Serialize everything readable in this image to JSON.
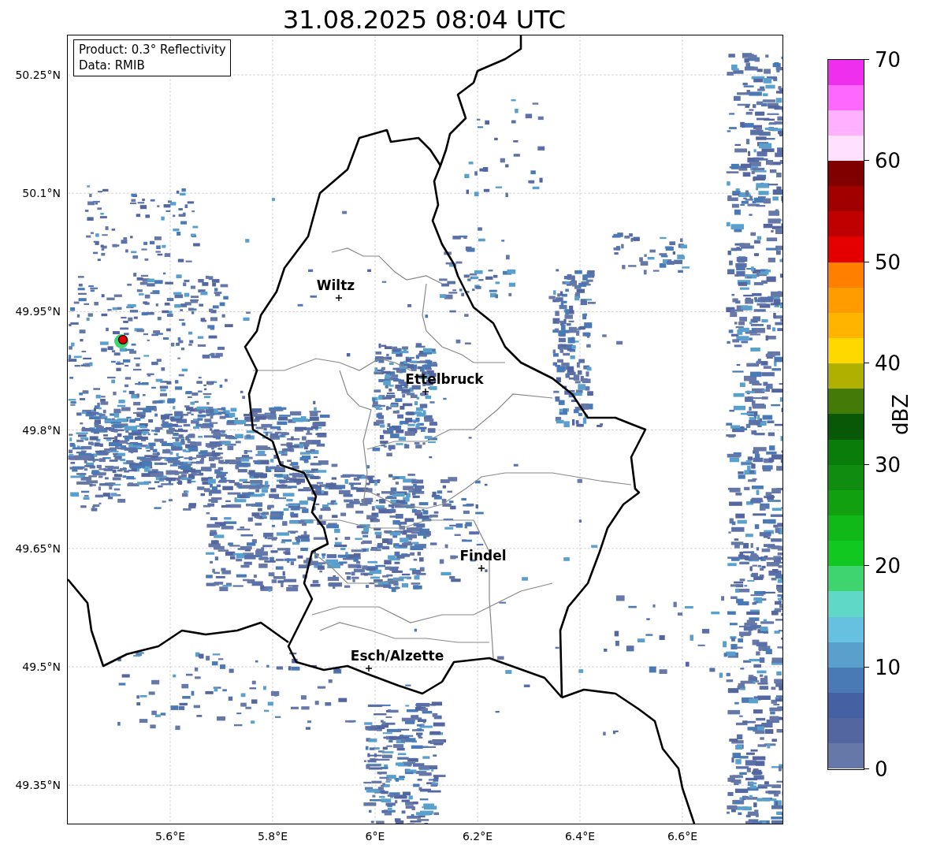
{
  "title": "31.08.2025 08:04 UTC",
  "info_box": [
    "Product: 0.3° Reflectivity",
    "Data: RMIB"
  ],
  "y_ticks": [
    "50.25°N",
    "50.1°N",
    "49.95°N",
    "49.8°N",
    "49.65°N",
    "49.5°N",
    "49.35°N"
  ],
  "x_ticks": [
    "5.6°E",
    "5.8°E",
    "6°E",
    "6.2°E",
    "6.4°E",
    "6.6°E"
  ],
  "cities": [
    {
      "name": "Wiltz"
    },
    {
      "name": "Ettelbruck"
    },
    {
      "name": "Findel"
    },
    {
      "name": "Esch/Alzette"
    }
  ],
  "colorbar": {
    "label": "dBZ",
    "ticks": [
      "70",
      "60",
      "50",
      "40",
      "30",
      "20",
      "10",
      "0"
    ],
    "bins": [
      {
        "color": "#ee30ee"
      },
      {
        "color": "#ff68ff"
      },
      {
        "color": "#ffb0ff"
      },
      {
        "color": "#ffe0ff"
      },
      {
        "color": "#800000"
      },
      {
        "color": "#a00000"
      },
      {
        "color": "#c00000"
      },
      {
        "color": "#e40000"
      },
      {
        "color": "#ff8000"
      },
      {
        "color": "#ff9c00"
      },
      {
        "color": "#ffb400"
      },
      {
        "color": "#ffd800"
      },
      {
        "color": "#b0b000"
      },
      {
        "color": "#447a08"
      },
      {
        "color": "#085808"
      },
      {
        "color": "#0a7c0a"
      },
      {
        "color": "#108c10"
      },
      {
        "color": "#10a010"
      },
      {
        "color": "#10b818"
      },
      {
        "color": "#10c820"
      },
      {
        "color": "#40d470"
      },
      {
        "color": "#60d8c8"
      },
      {
        "color": "#66c0e0"
      },
      {
        "color": "#5aa0cc"
      },
      {
        "color": "#4a7ab6"
      },
      {
        "color": "#4660a4"
      },
      {
        "color": "#5466a0"
      },
      {
        "color": "#6678a8"
      }
    ]
  }
}
